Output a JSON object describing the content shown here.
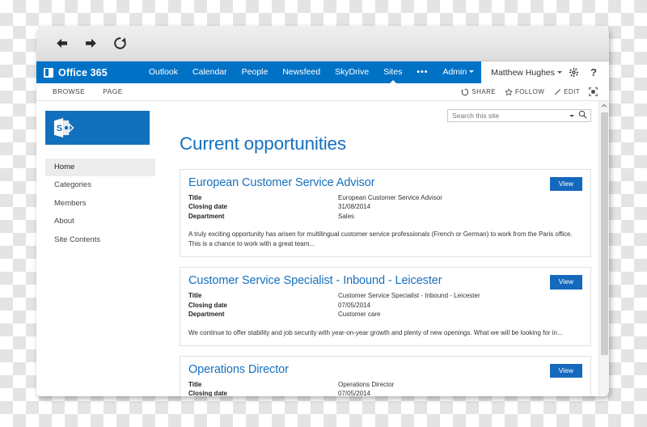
{
  "browser": {
    "back_icon": "arrow-left-icon",
    "forward_icon": "arrow-right-icon",
    "reload_icon": "reload-icon"
  },
  "suite_bar": {
    "brand": "Office 365",
    "brand_icon": "office-waffle-icon",
    "links": [
      {
        "label": "Outlook",
        "active": false
      },
      {
        "label": "Calendar",
        "active": false
      },
      {
        "label": "People",
        "active": false
      },
      {
        "label": "Newsfeed",
        "active": false
      },
      {
        "label": "SkyDrive",
        "active": false
      },
      {
        "label": "Sites",
        "active": true
      }
    ],
    "overflow_label": "•••",
    "admin_label": "Admin",
    "user_name": "Matthew Hughes",
    "settings_icon": "gear-icon",
    "help_label": "?",
    "help_icon": "help-icon"
  },
  "ribbon": {
    "tabs": [
      "BROWSE",
      "PAGE"
    ],
    "actions": [
      {
        "label": "SHARE",
        "icon": "share-icon"
      },
      {
        "label": "FOLLOW",
        "icon": "star-icon"
      },
      {
        "label": "EDIT",
        "icon": "pencil-icon"
      }
    ],
    "focus_icon": "focus-on-content-icon"
  },
  "sidebar": {
    "logo_icon": "sharepoint-logo-icon",
    "items": [
      {
        "label": "Home",
        "selected": true
      },
      {
        "label": "Categories",
        "selected": false
      },
      {
        "label": "Members",
        "selected": false
      },
      {
        "label": "About",
        "selected": false
      },
      {
        "label": "Site Contents",
        "selected": false
      }
    ]
  },
  "search": {
    "value": "",
    "placeholder": "Search this site",
    "search_icon": "search-icon",
    "dropdown_icon": "chevron-down-icon"
  },
  "main": {
    "page_title": "Current opportunities",
    "view_button_label": "View",
    "field_labels": {
      "title": "Title",
      "closing_date": "Closing date",
      "department": "Department"
    },
    "jobs": [
      {
        "title": "European Customer Service Advisor",
        "field_title": "European Customer Service Advisor",
        "closing_date": "31/08/2014",
        "department": "Sales",
        "description": "A truly exciting opportunity has arisen for multilingual customer service professionals (French or German) to work from the Paris office. This is a chance to work with a great team..."
      },
      {
        "title": "Customer Service Specialist - Inbound - Leicester",
        "field_title": "Customer Service Specialist - Inbound - Leicester",
        "closing_date": "07/05/2014",
        "department": "Customer care",
        "description": "We continue to offer stability and job security with year-on-year growth and plenty of new openings. What we will be looking for in..."
      },
      {
        "title": "Operations Director",
        "field_title": "Operations Director",
        "closing_date": "07/05/2014",
        "department": "",
        "description": ""
      }
    ]
  },
  "colors": {
    "suite_bar_blue": "#0072c6",
    "link_blue": "#1670bf",
    "button_blue": "#1569bd",
    "logo_blue": "#1270bd"
  }
}
